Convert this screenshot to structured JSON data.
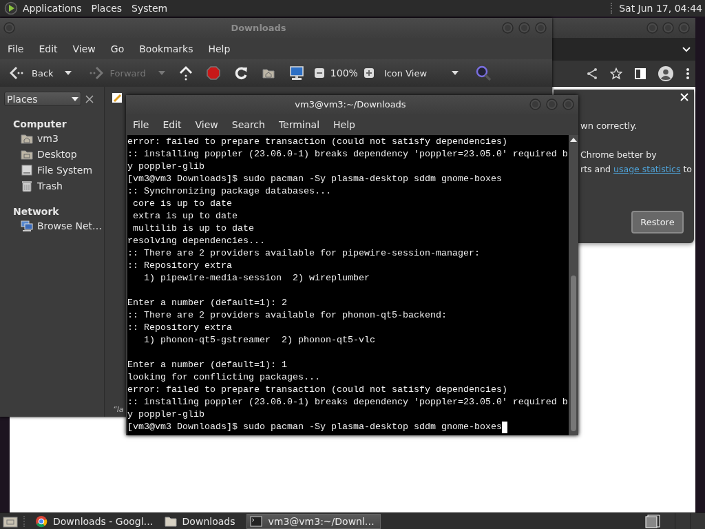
{
  "top_panel": {
    "menus": [
      "Applications",
      "Places",
      "System"
    ],
    "clock": "Sat Jun 17, 04:44"
  },
  "chrome": {
    "infobar": {
      "line_1": "wn correctly.",
      "line_2": "Chrome better by",
      "line_3": {
        "before": "rts and ",
        "link": "usage statistics",
        "after": " to"
      },
      "button": "Restore"
    }
  },
  "file_manager": {
    "title": "Downloads",
    "menu": [
      "File",
      "Edit",
      "View",
      "Go",
      "Bookmarks",
      "Help"
    ],
    "toolbar": {
      "back": {
        "label": "Back",
        "disabled": false
      },
      "forward": {
        "label": "Forward",
        "disabled": true
      },
      "zoom": "100%",
      "view": "Icon View"
    },
    "sidebar": {
      "selector": "Places",
      "sections": [
        {
          "title": "Computer",
          "children": [
            {
              "kind": "home",
              "label": "vm3",
              "selected": false
            },
            {
              "kind": "desktop",
              "label": "Desktop",
              "selected": false
            },
            {
              "kind": "drive",
              "label": "File System",
              "selected": false
            },
            {
              "kind": "trash",
              "label": "Trash",
              "selected": false
            }
          ]
        },
        {
          "title": "Network",
          "children": [
            {
              "kind": "network",
              "label": "Browse Net…",
              "selected": false
            }
          ]
        }
      ]
    },
    "status": "“la"
  },
  "terminal": {
    "title": "vm3@vm3:~/Downloads",
    "menu": [
      "File",
      "Edit",
      "View",
      "Search",
      "Terminal",
      "Help"
    ],
    "lines": [
      {
        "kind": "text",
        "text": "error: failed to prepare transaction (could not satisfy dependencies)"
      },
      {
        "kind": "text",
        "text": ":: installing poppler (23.06.0-1) breaks dependency 'poppler=23.05.0' required b"
      },
      {
        "kind": "text",
        "text": "y poppler-glib"
      },
      {
        "kind": "text",
        "text": "[vm3@vm3 Downloads]$ sudo pacman -Sy plasma-desktop sddm gnome-boxes"
      },
      {
        "kind": "text",
        "text": ":: Synchronizing package databases..."
      },
      {
        "kind": "text",
        "text": " core is up to date"
      },
      {
        "kind": "text",
        "text": " extra is up to date"
      },
      {
        "kind": "text",
        "text": " multilib is up to date"
      },
      {
        "kind": "text",
        "text": "resolving dependencies..."
      },
      {
        "kind": "text",
        "text": ":: There are 2 providers available for pipewire-session-manager:"
      },
      {
        "kind": "text",
        "text": ":: Repository extra"
      },
      {
        "kind": "text",
        "text": "   1) pipewire-media-session  2) wireplumber"
      },
      {
        "kind": "blank"
      },
      {
        "kind": "text",
        "text": "Enter a number (default=1): 2"
      },
      {
        "kind": "text",
        "text": ":: There are 2 providers available for phonon-qt5-backend:"
      },
      {
        "kind": "text",
        "text": ":: Repository extra"
      },
      {
        "kind": "text",
        "text": "   1) phonon-qt5-gstreamer  2) phonon-qt5-vlc"
      },
      {
        "kind": "blank"
      },
      {
        "kind": "text",
        "text": "Enter a number (default=1): 1"
      },
      {
        "kind": "text",
        "text": "looking for conflicting packages..."
      },
      {
        "kind": "text",
        "text": "error: failed to prepare transaction (could not satisfy dependencies)"
      },
      {
        "kind": "text",
        "text": ":: installing poppler (23.06.0-1) breaks dependency 'poppler=23.05.0' required b"
      },
      {
        "kind": "text",
        "text": "y poppler-glib"
      },
      {
        "kind": "text",
        "text": "[vm3@vm3 Downloads]$ sudo pacman -Sy plasma-desktop sddm gnome-boxes"
      }
    ],
    "cursor": true
  },
  "taskbar": {
    "tasks": [
      {
        "kind": "browser",
        "label": "Downloads - Googl…",
        "selected": false
      },
      {
        "kind": "folder",
        "label": "Downloads",
        "selected": false
      },
      {
        "kind": "terminal",
        "label": "vm3@vm3:~/Downl…",
        "selected": true
      }
    ]
  }
}
